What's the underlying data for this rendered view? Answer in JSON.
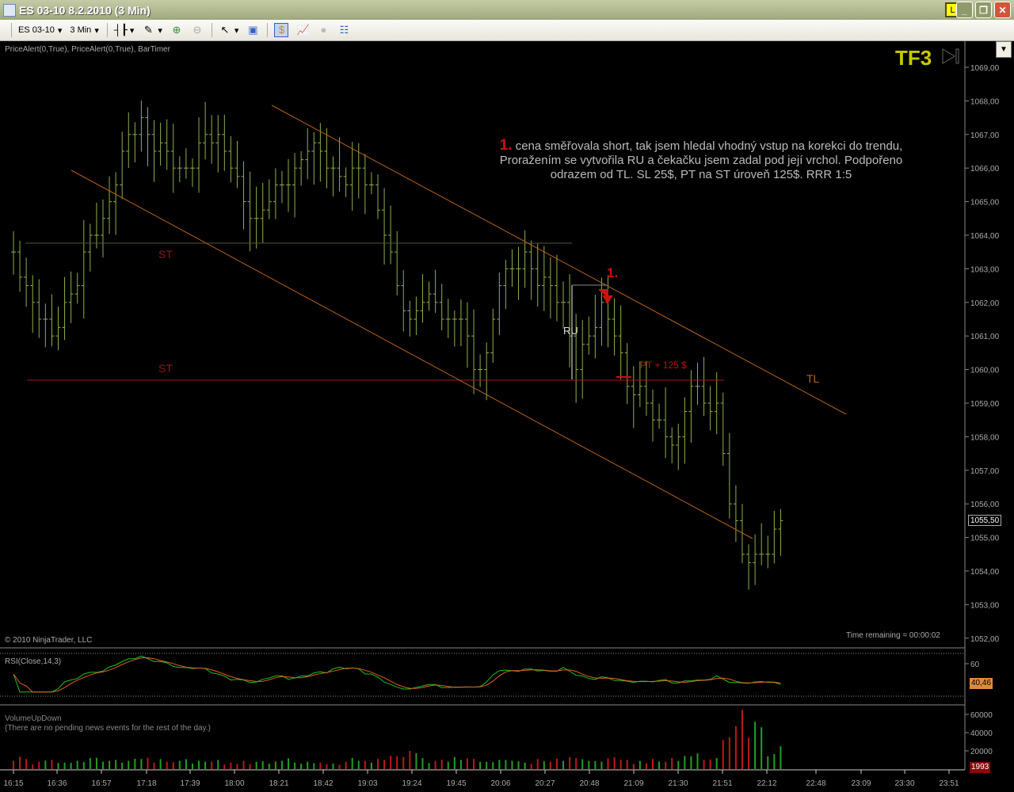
{
  "window": {
    "title": "ES 03-10  8.2.2010 (3 Min)",
    "lock_badge": "L"
  },
  "toolbar": {
    "instrument": "ES 03-10",
    "interval": "3 Min"
  },
  "indicators_label": "PriceAlert(0,True), PriceAlert(0,True), BarTimer",
  "tf_label": "TF3",
  "annotation": {
    "num": "1.",
    "line1": "cena  směřovala short, tak jsem hledal vhodný vstup na korekci do trendu,",
    "line2": "Proražením se vytvořila RU a čekačku jsem zadal pod její vrchol. Podpořeno",
    "line3": "odrazem od TL. SL 25$, PT na ST  úroveň 125$.  RRR 1:5"
  },
  "chart_labels": {
    "st_upper": "ST",
    "st_lower": "ST",
    "ru": "RU",
    "trade_num": "1.",
    "pt": "PT + 125 $",
    "tl": "TL"
  },
  "copyright": "© 2010 NinjaTrader, LLC",
  "time_remaining": "Time remaining = 00:00:02",
  "rsi_label": "RSI(Close,14,3)",
  "volume_label": "VolumeUpDown",
  "news_text": "(There are no pending news events for the rest of the day.)",
  "colors": {
    "bar": "#8db04a",
    "st_red": "#b01818",
    "trend": "#b8621a",
    "rsi": "#20c020",
    "rsi_avg": "#e06020",
    "vol_up": "#20a020",
    "vol_down": "#c01818"
  },
  "chart_data": [
    {
      "type": "ohlc",
      "title": "ES 03-10 3 Min",
      "price_axis": {
        "min": 1052,
        "max": 1069,
        "ticks": [
          "1069,00",
          "1068,00",
          "1067,00",
          "1066,00",
          "1065,00",
          "1064,00",
          "1063,00",
          "1062,00",
          "1061,00",
          "1060,00",
          "1059,00",
          "1058,00",
          "1057,00",
          "1056,00",
          "1055,00",
          "1054,00",
          "1053,00",
          "1052,00"
        ]
      },
      "time_ticks": [
        "16:15",
        "16:36",
        "16:57",
        "17:18",
        "17:39",
        "18:00",
        "18:21",
        "18:42",
        "19:03",
        "19:24",
        "19:45",
        "20:06",
        "20:27",
        "20:48",
        "21:09",
        "21:30",
        "21:51",
        "22:12",
        "22:48",
        "23:09",
        "23:30",
        "23:51"
      ],
      "closes_every_2_bars": [
        1063.5,
        1062.5,
        1061.5,
        1061,
        1062,
        1062.5,
        1064,
        1064.5,
        1065.5,
        1067,
        1067.5,
        1066.5,
        1066.5,
        1066,
        1066,
        1067,
        1067,
        1066,
        1065,
        1064.5,
        1065,
        1065.5,
        1066,
        1066.5,
        1066.5,
        1066,
        1065.5,
        1066,
        1065.5,
        1064,
        1062.5,
        1061.5,
        1062,
        1062,
        1061.5,
        1061.5,
        1060,
        1060.5,
        1062.5,
        1063,
        1063.5,
        1062.5,
        1062.5,
        1062,
        1060,
        1061,
        1062,
        1061,
        1059.5,
        1059.5,
        1058.5,
        1058,
        1058,
        1059.5,
        1059,
        1059,
        1056,
        1054.5,
        1054.5,
        1054.5,
        1055.5
      ],
      "last_price": "1055,50",
      "st_levels": [
        1063.75,
        1059.75
      ]
    },
    {
      "type": "line",
      "title": "RSI(Close,14,3)",
      "ticks": [
        "60"
      ],
      "last_value": "40,46",
      "guide_levels": [
        70,
        30
      ]
    },
    {
      "type": "bar",
      "title": "VolumeUpDown",
      "ticks": [
        "60000",
        "40000",
        "20000"
      ],
      "last_value": "1993",
      "volumes_every_2_bars": [
        9000,
        11000,
        8000,
        10000,
        7000,
        9000,
        12000,
        8000,
        10000,
        9000,
        11000,
        7000,
        8000,
        9000,
        6000,
        8000,
        10000,
        7000,
        9000,
        8000,
        6000,
        9000,
        7000,
        8000,
        7000,
        6000,
        8000,
        9000,
        7000,
        10000,
        14000,
        20000,
        12000,
        9000,
        8000,
        10000,
        11000,
        8000,
        10000,
        9000,
        7000,
        11000,
        8000,
        9000,
        12000,
        9000,
        8000,
        13000,
        10000,
        9000,
        11000,
        8000,
        9000,
        14000,
        10000,
        12000,
        35000,
        65000,
        52000,
        14000,
        25000
      ]
    }
  ]
}
